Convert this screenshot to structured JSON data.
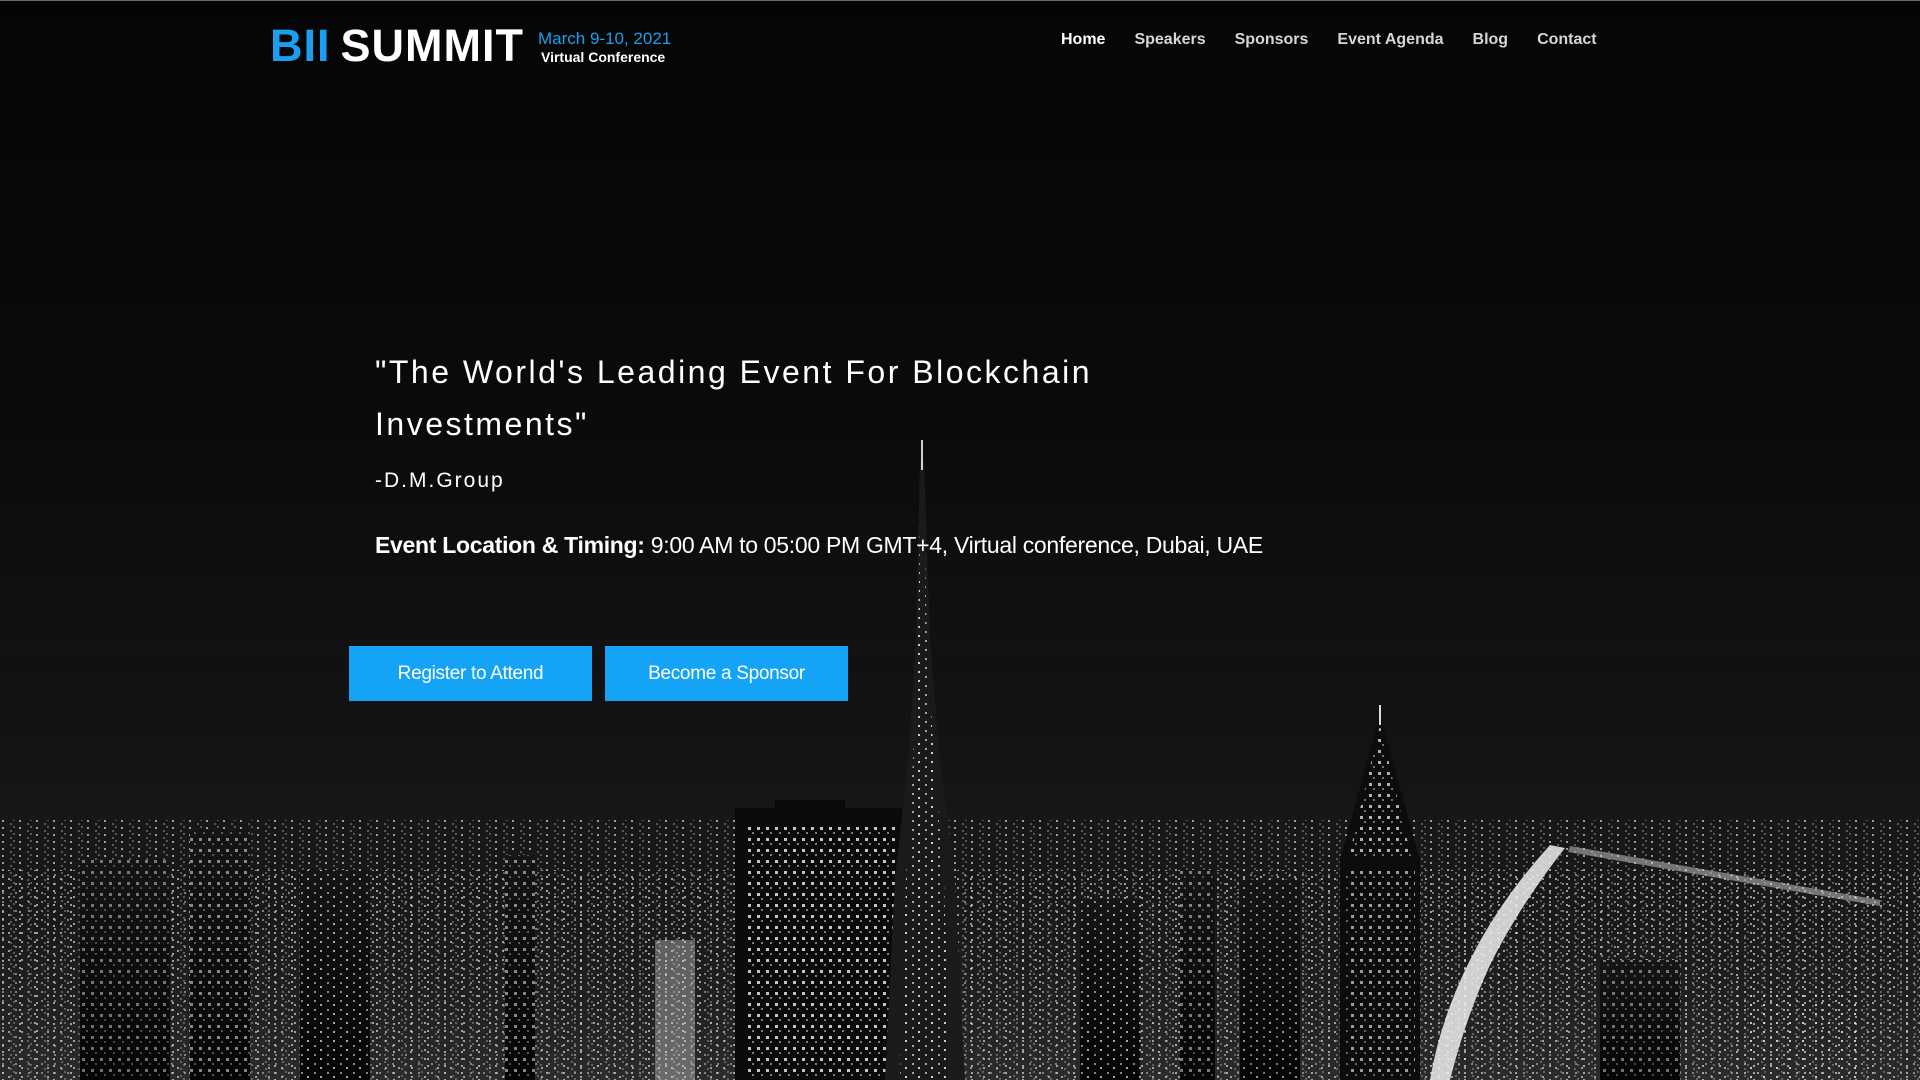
{
  "logo": {
    "mark_bii": "BII",
    "mark_summit": "SUMMIT",
    "date": "March 9-10, 2021",
    "subtitle": "Virtual Conference"
  },
  "nav": {
    "items": [
      {
        "label": "Home",
        "active": true
      },
      {
        "label": "Speakers"
      },
      {
        "label": "Sponsors"
      },
      {
        "label": "Event Agenda"
      },
      {
        "label": "Blog"
      },
      {
        "label": "Contact"
      }
    ]
  },
  "hero": {
    "quote": "\"The World's Leading Event For Blockchain Investments\"",
    "author": "-D.M.Group",
    "location_label": "Event Location & Timing:",
    "location_value": " 9:00 AM to 05:00 PM GMT+4, Virtual conference, Dubai, UAE",
    "background": "dubai-night-skyline-image"
  },
  "buttons": {
    "register": "Register to Attend",
    "sponsor": "Become a Sponsor"
  },
  "colors": {
    "accent": "#1a9ff0",
    "button": "#14a3f5",
    "background": "#000000"
  }
}
